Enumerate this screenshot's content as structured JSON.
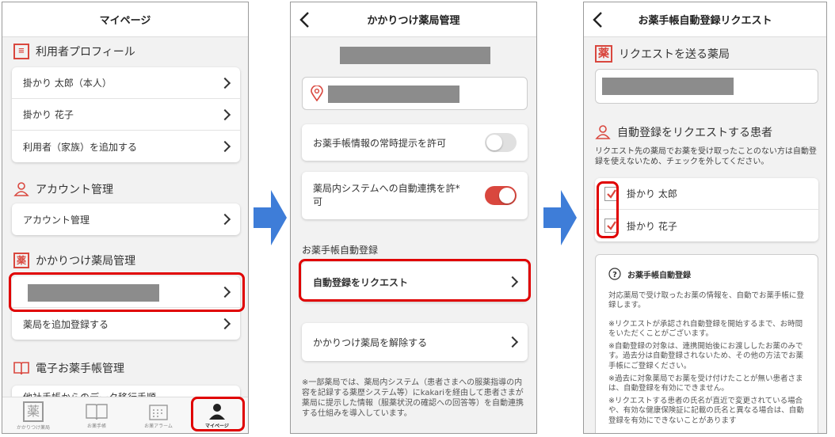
{
  "colors": {
    "accent": "#d9473e",
    "highlight": "#e00000",
    "arrow": "#3e7dd8",
    "toggle_off": "#e0e0e0"
  },
  "screen1": {
    "title": "マイページ",
    "profile_section": "利用者プロフィール",
    "users": [
      "掛かり 太郎（本人）",
      "掛かり 花子",
      "利用者（家族）を追加する"
    ],
    "account_section": "アカウント管理",
    "account_item": "アカウント管理",
    "pharmacy_section": "かかりつけ薬局管理",
    "pharmacy_add": "薬局を追加登録する",
    "ebook_section": "電子お薬手帳管理",
    "ebook_item_partial": "他社手帳からのデータ移行手順",
    "nav": [
      {
        "label": "かかりつけ薬局",
        "icon": "pharmacy-icon"
      },
      {
        "label": "お薬手帳",
        "icon": "book-icon"
      },
      {
        "label": "お薬アラーム",
        "icon": "calendar-icon"
      },
      {
        "label": "マイページ",
        "icon": "person-icon"
      }
    ],
    "active_nav": "マイページ"
  },
  "screen2": {
    "title": "かかりつけ薬局管理",
    "toggle1_label": "お薬手帳情報の常時提示を許可",
    "toggle1_on": false,
    "toggle2_label": "薬局内システムへの自動連携を許*可",
    "toggle2_on": true,
    "auto_section": "お薬手帳自動登録",
    "request_button": "自動登録をリクエスト",
    "unregister_button": "かかりつけ薬局を解除する",
    "footnote": "※一部薬局では、薬局内システム（患者さまへの服薬指導の内容を記録する薬歴システム等）にkakariを経由して患者さまが薬局に提示した情報（服薬状況の確認への回答等）を自動連携する仕組みを導入しています。"
  },
  "screen3": {
    "title": "お薬手帳自動登録リクエスト",
    "pharmacy_section": "リクエストを送る薬局",
    "patient_section": "自動登録をリクエストする患者",
    "patient_note": "リクエスト先の薬局でお薬を受け取ったことのない方は自動登録を使えないため、チェックを外してください。",
    "patients": [
      {
        "name": "掛かり 太郎",
        "checked": true
      },
      {
        "name": "掛かり 花子",
        "checked": true
      }
    ],
    "info_title": "お薬手帳自動登録",
    "info_intro": "対応薬局で受け取ったお薬の情報を、自動でお薬手帳に登録します。",
    "info_bullets": [
      "※リクエストが承認され自動登録を開始するまで、お時間をいただくことがございます。",
      "※自動登録の対象は、連携開始後にお渡ししたお薬のみです。過去分は自動登録されないため、その他の方法でお薬手帳にご登録ください。",
      "※過去に対象薬局でお薬を受け付けたことが無い患者さまは、自動登録を有効にできません。",
      "※リクエストする患者の氏名が直近で変更されている場合や、有効な健康保険証に記載の氏名と異なる場合は、自動登録を有効にできないことがあります"
    ]
  }
}
